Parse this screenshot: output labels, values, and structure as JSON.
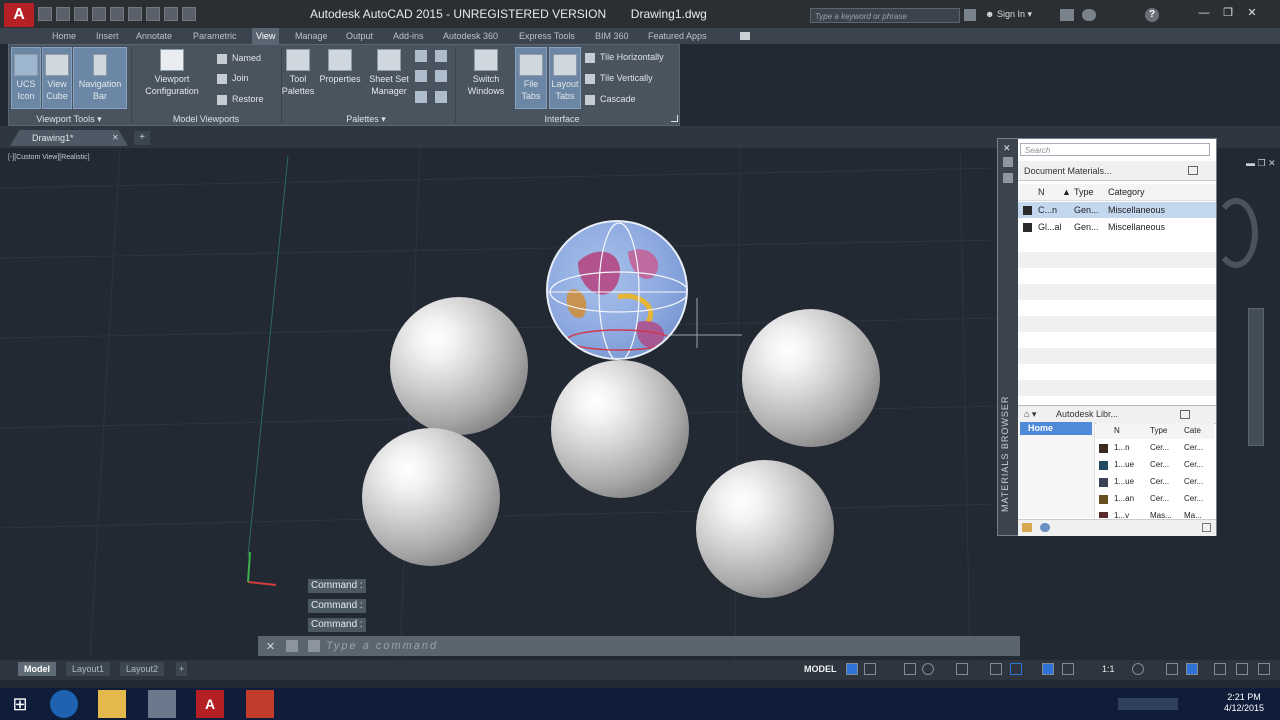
{
  "window": {
    "title": "Autodesk AutoCAD 2015 - UNREGISTERED VERSION",
    "file_name": "Drawing1.dwg",
    "app_logo": "A",
    "search_placeholder": "Type a keyword or phrase",
    "sign_in": "Sign In",
    "help": "?"
  },
  "ribbon_tabs": [
    "Home",
    "Insert",
    "Annotate",
    "Parametric",
    "View",
    "Manage",
    "Output",
    "Add-ins",
    "Autodesk 360",
    "Express Tools",
    "BIM 360",
    "Featured Apps"
  ],
  "ribbon": {
    "viewport_tools": {
      "label": "Viewport Tools",
      "buttons": [
        "UCS Icon",
        "View Cube",
        "Navigation Bar"
      ]
    },
    "model_viewports": {
      "label": "Model Viewports",
      "viewport_configuration": "Viewport Configuration",
      "named": "Named",
      "join": "Join",
      "restore": "Restore"
    },
    "palettes": {
      "label": "Palettes",
      "tool_palettes": "Tool Palettes",
      "properties": "Properties",
      "sheet_set_manager": "Sheet Set Manager"
    },
    "interface": {
      "label": "Interface",
      "switch_windows": "Switch Windows",
      "file_tabs": "File Tabs",
      "layout_tabs": "Layout Tabs",
      "tile_horizontally": "Tile Horizontally",
      "tile_vertically": "Tile Vertically",
      "cascade": "Cascade"
    }
  },
  "file_tab": {
    "name": "Drawing1*",
    "new_tab": "+"
  },
  "viewport": {
    "label": "[-][Custom View][Realistic]"
  },
  "command": {
    "history": [
      "Command :",
      "Command :",
      "Command :"
    ],
    "placeholder": "Type a command"
  },
  "materials_browser": {
    "side_title": "MATERIALS BROWSER",
    "search_placeholder": "Search",
    "document_materials": "Document Materials...",
    "columns": {
      "name": "N",
      "type": "Type",
      "category": "Category"
    },
    "rows": [
      {
        "name": "C...n",
        "type": "Gen...",
        "category": "Miscellaneous",
        "color": "#2a2a2a",
        "selected": true
      },
      {
        "name": "Gl...al",
        "type": "Gen...",
        "category": "Miscellaneous",
        "color": "#2a2a2a",
        "selected": false
      }
    ],
    "library": "Autodesk Libr...",
    "home": "Home",
    "lib_columns": {
      "name": "N",
      "type": "Type",
      "category": "Cate"
    },
    "lib_rows": [
      {
        "name": "1...n",
        "type": "Cer...",
        "category": "Cer...",
        "color": "#3a2a22"
      },
      {
        "name": "1...ue",
        "type": "Cer...",
        "category": "Cer...",
        "color": "#214a60"
      },
      {
        "name": "1...ue",
        "type": "Cer...",
        "category": "Cer...",
        "color": "#3a4258"
      },
      {
        "name": "1...an",
        "type": "Cer...",
        "category": "Cer...",
        "color": "#6a5020"
      },
      {
        "name": "1...v",
        "type": "Mas...",
        "category": "Ma...",
        "color": "#5a2a2a"
      }
    ]
  },
  "layout_tabs": [
    "Model",
    "Layout1",
    "Layout2"
  ],
  "layout_add": "+",
  "status": {
    "model": "MODEL",
    "scale": "1:1"
  },
  "taskbar": {
    "time": "2:21 PM",
    "date": "4/12/2015"
  }
}
